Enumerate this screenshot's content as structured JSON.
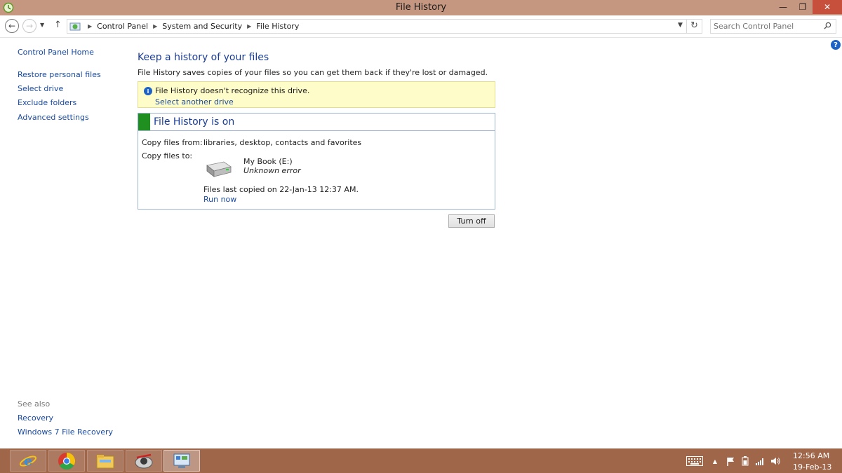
{
  "window": {
    "title": "File History",
    "minimize_glyph": "—",
    "maximize_glyph": "❐",
    "close_glyph": "✕"
  },
  "nav": {
    "breadcrumbs": [
      "Control Panel",
      "System and Security",
      "File History"
    ],
    "search_placeholder": "Search Control Panel"
  },
  "sidebar": {
    "home_label": "Control Panel Home",
    "items": [
      "Restore personal files",
      "Select drive",
      "Exclude folders",
      "Advanced settings"
    ],
    "see_also_label": "See also",
    "see_also_items": [
      "Recovery",
      "Windows 7 File Recovery"
    ]
  },
  "main": {
    "heading": "Keep a history of your files",
    "description": "File History saves copies of your files so you can get them back if they're lost or damaged.",
    "notice": {
      "message": "File History doesn't recognize this drive.",
      "link": "Select another drive"
    },
    "status": {
      "title": "File History is on",
      "copy_from_label": "Copy files from:",
      "copy_from_value": "libraries, desktop, contacts and favorites",
      "copy_to_label": "Copy files to:",
      "drive_name": "My Book (E:)",
      "drive_error": "Unknown error",
      "last_copied": "Files last copied on 22-Jan-13 12:37 AM.",
      "run_now": "Run now"
    },
    "turn_off_label": "Turn off"
  },
  "taskbar": {
    "apps": [
      "internet-explorer-icon",
      "chrome-icon",
      "file-explorer-icon",
      "backup-app-icon",
      "control-panel-icon"
    ],
    "clock_time": "12:56 AM",
    "clock_date": "19-Feb-13"
  },
  "colors": {
    "titlebar": "#c59780",
    "taskbar": "#a0664a",
    "link": "#1a4aa0",
    "heading": "#1a3c94",
    "status_green": "#1f8f1f",
    "notice_bg": "#fefcc8"
  }
}
